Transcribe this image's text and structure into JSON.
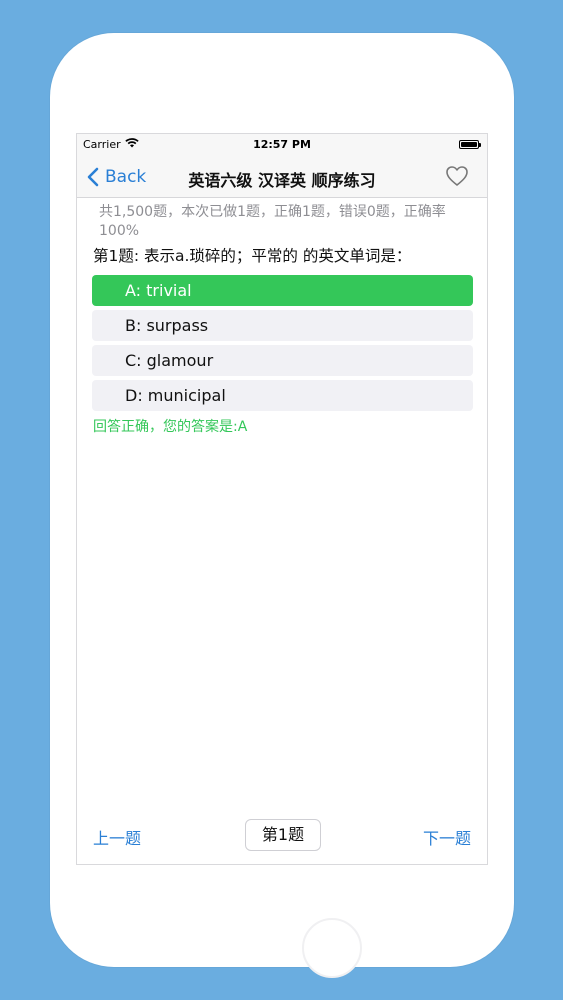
{
  "status_bar": {
    "carrier": "Carrier",
    "time": "12:57 PM"
  },
  "nav": {
    "back_label": "Back",
    "title": "英语六级 汉译英 顺序练习",
    "favorite_icon": "heart-outline-icon"
  },
  "stats_text": "共1,500题，本次已做1题，正确1题，错误0题，正确率100%",
  "question": {
    "text": "第1题: 表示a.琐碎的；平常的 的英文单词是："
  },
  "options": [
    {
      "label": "A: trivial",
      "state": "correct"
    },
    {
      "label": "B: surpass",
      "state": "normal"
    },
    {
      "label": "C: glamour",
      "state": "normal"
    },
    {
      "label": "D: municipal",
      "state": "normal"
    }
  ],
  "feedback": "回答正确，您的答案是:A",
  "bottom": {
    "prev_label": "上一题",
    "page_label": "第1题",
    "next_label": "下一题"
  },
  "colors": {
    "accent": "#2a7fd5",
    "correct": "#34c759",
    "background": "#6aade0",
    "option_bg": "#f1f1f5"
  }
}
